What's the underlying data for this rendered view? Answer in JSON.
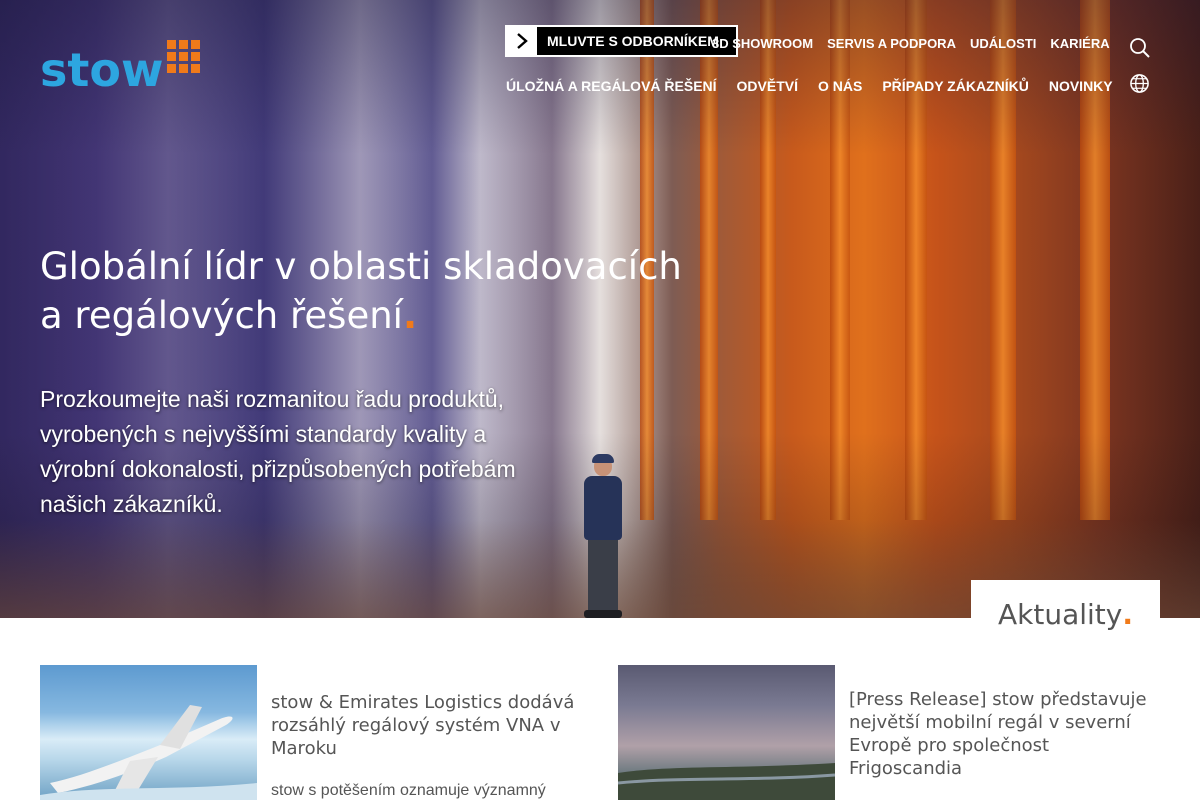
{
  "brand": {
    "logo_text": "stow",
    "logo_color": "#2da6e0",
    "accent_color": "#f07a1a"
  },
  "header": {
    "cta_label": "MLUVTE S ODBORNÍKEM",
    "top_links": [
      "3D SHOWROOM",
      "SERVIS A PODPORA",
      "UDÁLOSTI",
      "KARIÉRA"
    ],
    "main_links": [
      "ÚLOŽNÁ A REGÁLOVÁ ŘEŠENÍ",
      "ODVĚTVÍ",
      "O NÁS",
      "PŘÍPADY ZÁKAZNÍKŮ",
      "NOVINKY"
    ],
    "icons": [
      "search-icon",
      "globe-icon",
      "chevron-right-icon"
    ]
  },
  "hero": {
    "title_line1": "Globální lídr v oblasti skladovacích",
    "title_line2": "a regálových řešení",
    "title_dot": ".",
    "subtitle": "Prozkoumejte naši rozmanitou řadu produktů, vyrobených s nejvyššími standardy kvality a výrobní dokonalosti, přizpůsobených potřebám našich zákazníků."
  },
  "news": {
    "section_title": "Aktuality",
    "section_dot": ".",
    "items": [
      {
        "title": "stow & Emirates Logistics dodává rozsáhlý regálový systém VNA v Maroku",
        "excerpt": "stow s potěšením oznamuje významný"
      },
      {
        "title": "[Press Release] stow představuje největší mobilní regál v severní Evropě pro společnost Frigoscandia",
        "excerpt": ""
      }
    ]
  }
}
